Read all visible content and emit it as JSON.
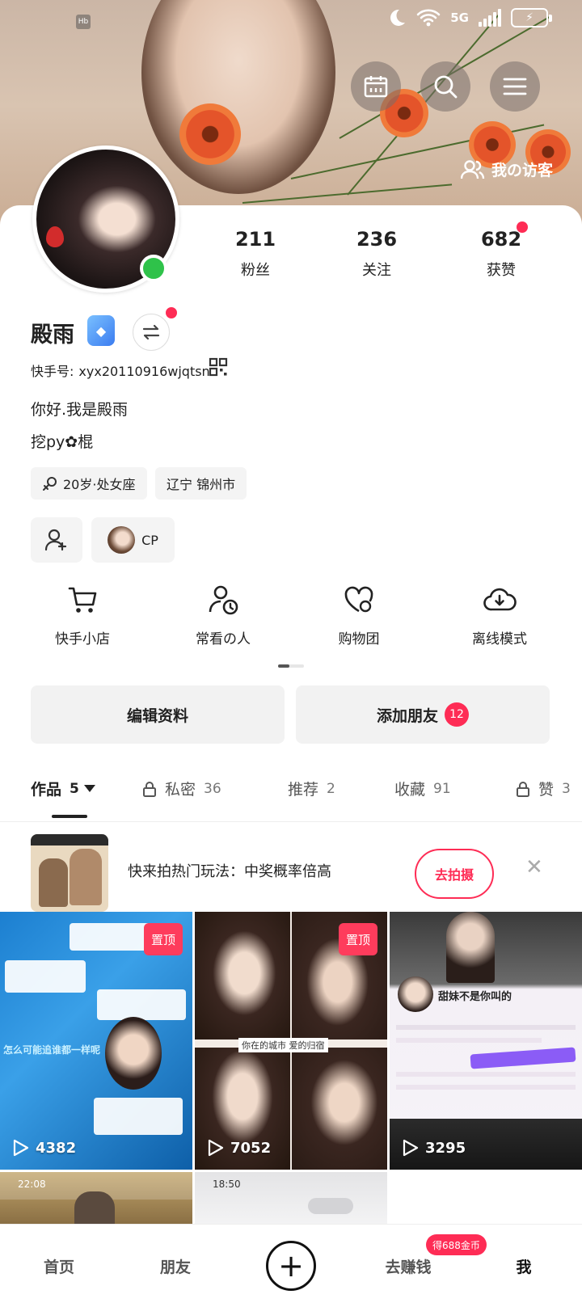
{
  "status_bar": {
    "network": "5G",
    "small_icon_text": "Hb"
  },
  "header": {
    "visitors_label": "我の访客"
  },
  "profile": {
    "name": "殿雨",
    "kuaishou_id_label": "快手号:",
    "kuaishou_id": "xyx20110916wjqtsn",
    "bio_line1": "你好.我是殿雨",
    "bio_line2": "挖py✿棍",
    "tags": [
      "20岁·处女座",
      "辽宁 锦州市"
    ],
    "cp_label": "CP"
  },
  "stats": [
    {
      "value": "211",
      "label": "粉丝"
    },
    {
      "value": "236",
      "label": "关注"
    },
    {
      "value": "682",
      "label": "获赞"
    }
  ],
  "quick_actions": [
    {
      "label": "快手小店",
      "icon": "cart-icon"
    },
    {
      "label": "常看の人",
      "icon": "person-clock-icon"
    },
    {
      "label": "购物团",
      "icon": "heart-group-icon"
    },
    {
      "label": "离线模式",
      "icon": "cloud-download-icon"
    }
  ],
  "buttons": {
    "edit_profile": "编辑资料",
    "add_friends": "添加朋友",
    "add_friends_count": "12"
  },
  "tabs": [
    {
      "label": "作品",
      "count": "5",
      "active": true
    },
    {
      "label": "私密",
      "count": "36"
    },
    {
      "label": "推荐",
      "count": "2"
    },
    {
      "label": "收藏",
      "count": "91"
    },
    {
      "label": "赞",
      "count": "3"
    }
  ],
  "promo": {
    "text": "快来拍热门玩法：中奖概率倍高",
    "button": "去拍摄"
  },
  "grid": [
    {
      "pin_label": "置顶",
      "views": "4382",
      "caption": "怎么可能追谁都一样呢"
    },
    {
      "pin_label": "置顶",
      "views": "7052",
      "caption": "你在的城市 爱的归宿"
    },
    {
      "views": "3295",
      "caption": "甜妹不是你叫的"
    },
    {
      "time": "22:08"
    },
    {
      "time": "18:50"
    }
  ],
  "nav": {
    "home": "首页",
    "friends": "朋友",
    "earn": "去赚钱",
    "earn_badge": "得688金币",
    "me": "我"
  },
  "colors": {
    "accent": "#fe2c55",
    "online": "#2fc24a"
  }
}
